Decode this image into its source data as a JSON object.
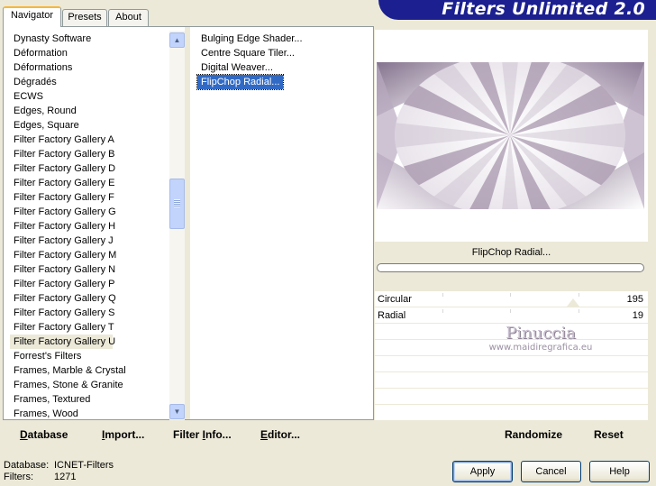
{
  "window": {
    "title": "Filters Unlimited 2.0"
  },
  "tabs": [
    {
      "label": "Navigator",
      "active": true
    },
    {
      "label": "Presets",
      "active": false
    },
    {
      "label": "About",
      "active": false
    }
  ],
  "categories": {
    "items": [
      "Dynasty Software",
      "Déformation",
      "Déformations",
      "Dégradés",
      "ECWS",
      "Edges, Round",
      "Edges, Square",
      "Filter Factory Gallery A",
      "Filter Factory Gallery B",
      "Filter Factory Gallery D",
      "Filter Factory Gallery E",
      "Filter Factory Gallery F",
      "Filter Factory Gallery G",
      "Filter Factory Gallery H",
      "Filter Factory Gallery J",
      "Filter Factory Gallery M",
      "Filter Factory Gallery N",
      "Filter Factory Gallery P",
      "Filter Factory Gallery Q",
      "Filter Factory Gallery S",
      "Filter Factory Gallery T",
      "Filter Factory Gallery U",
      "Forrest's Filters",
      "Frames, Marble & Crystal",
      "Frames, Stone & Granite",
      "Frames, Textured",
      "Frames, Wood"
    ],
    "selected": "Filter Factory Gallery U",
    "scroll_position": 0.43
  },
  "filters": {
    "items": [
      "Bulging Edge Shader...",
      "Centre Square Tiler...",
      "Digital Weaver...",
      "FlipChop Radial..."
    ],
    "selected": "FlipChop Radial..."
  },
  "preview": {
    "filter_name": "FlipChop Radial...",
    "progress": 0
  },
  "parameters": [
    {
      "label": "Circular",
      "value": "195",
      "fraction": 0.76
    },
    {
      "label": "Radial",
      "value": "19",
      "fraction": 0.07
    }
  ],
  "watermark": {
    "name": "Pinuccia",
    "site": "www.maidiregrafica.eu"
  },
  "links": {
    "database": "Database",
    "import": "Import...",
    "filter_info": "Filter Info...",
    "editor": "Editor...",
    "randomize": "Randomize",
    "reset": "Reset"
  },
  "footer": {
    "database_label": "Database:",
    "database_value": "ICNET-Filters",
    "filters_label": "Filters:",
    "filters_value": "1271"
  },
  "buttons": {
    "apply": "Apply",
    "cancel": "Cancel",
    "help": "Help"
  },
  "colors": {
    "banner": "#1b1f8f",
    "selection": "#316ac5",
    "tab_highlight": "#f7b739",
    "window": "#ece9d8"
  }
}
